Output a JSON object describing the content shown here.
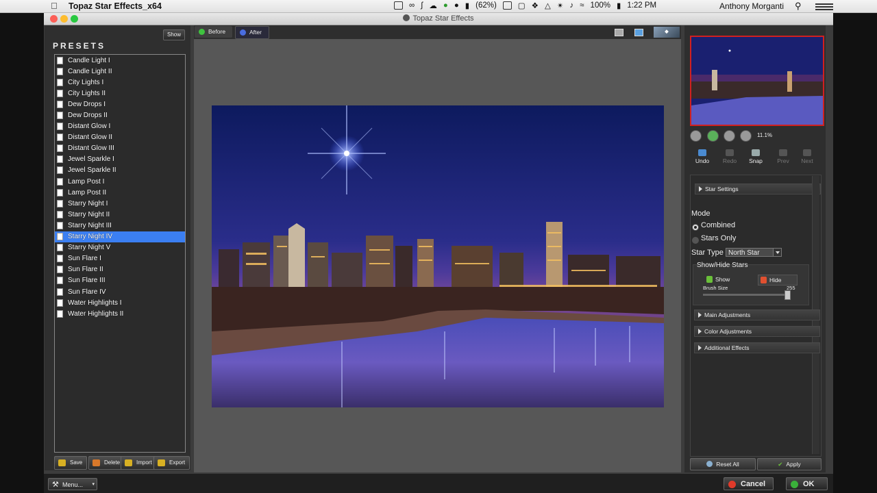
{
  "menubar": {
    "app_name": "Topaz Star Effects_x64",
    "battery": "(62%)",
    "volume": "100%",
    "clock": "1:22 PM",
    "user": "Anthony Morganti"
  },
  "window": {
    "title": "Topaz Star Effects"
  },
  "presets": {
    "title": "PRESETS",
    "show_label": "Show",
    "selected_index": 17,
    "items": [
      "Candle Light I",
      "Candle Light II",
      "City Lights I",
      "City Lights II",
      "Dew Drops I",
      "Dew Drops II",
      "Distant Glow I",
      "Distant Glow II",
      "Distant Glow III",
      "Jewel Sparkle I",
      "Jewel Sparkle II",
      "Lamp Post I",
      "Lamp Post II",
      "Starry Night I",
      "Starry Night II",
      "Starry Night III",
      "Starry Night IV",
      "Starry Night V",
      "Sun Flare I",
      "Sun Flare II",
      "Sun Flare III",
      "Sun Flare IV",
      "Water Highlights I",
      "Water Highlights II"
    ],
    "actions": {
      "save": "Save",
      "delete": "Delete",
      "import": "Import",
      "export": "Export"
    }
  },
  "view": {
    "before_tab": "Before",
    "after_tab": "After"
  },
  "navigator": {
    "zoom_level": "11.1%"
  },
  "history": {
    "undo": "Undo",
    "redo": "Redo",
    "snap": "Snap",
    "prev": "Prev",
    "next": "Next"
  },
  "settings": {
    "star_settings_header": "Star Settings",
    "mode_label": "Mode",
    "mode_options": [
      "Combined",
      "Stars Only"
    ],
    "mode_selected": "Combined",
    "star_type_label": "Star Type",
    "star_type_value": "North Star",
    "show_hide_label": "Show/Hide Stars",
    "show_btn": "Show",
    "hide_btn": "Hide",
    "brush_size_label": "Brush Size",
    "brush_size_value": "255",
    "main_adjustments": "Main Adjustments",
    "color_adjustments": "Color Adjustments",
    "additional_effects": "Additional Effects"
  },
  "footer": {
    "reset_all": "Reset All",
    "apply": "Apply",
    "menu": "Menu...",
    "cancel": "Cancel",
    "ok": "OK"
  },
  "colors": {
    "selection_blue": "#3b7ff2",
    "nav_border_red": "#d12020",
    "sky_top": "#0d1a5e",
    "sky_horizon": "#6a2f8a"
  }
}
